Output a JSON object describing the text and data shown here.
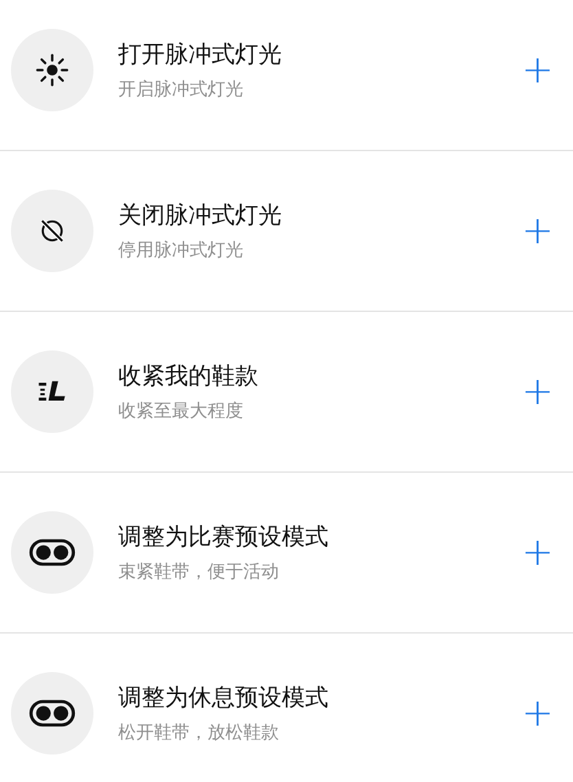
{
  "actions": [
    {
      "title": "打开脉冲式灯光",
      "subtitle": "开启脉冲式灯光",
      "add": "+"
    },
    {
      "title": "关闭脉冲式灯光",
      "subtitle": "停用脉冲式灯光",
      "add": "+"
    },
    {
      "title": "收紧我的鞋款",
      "subtitle": "收紧至最大程度",
      "add": "+"
    },
    {
      "title": "调整为比赛预设模式",
      "subtitle": "束紧鞋带，便于活动",
      "add": "+"
    },
    {
      "title": "调整为休息预设模式",
      "subtitle": "松开鞋带，放松鞋款",
      "add": "+"
    }
  ]
}
